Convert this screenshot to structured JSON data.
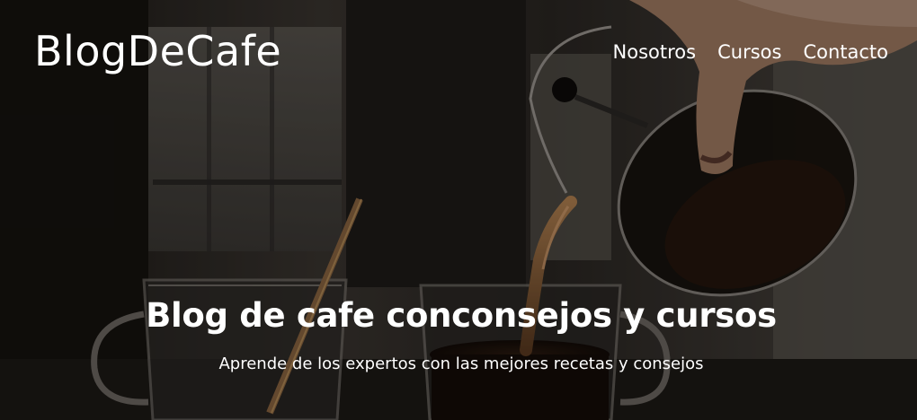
{
  "site": {
    "logo": "BlogDeCafe"
  },
  "nav": {
    "items": [
      {
        "label": "Nosotros"
      },
      {
        "label": "Cursos"
      },
      {
        "label": "Contacto"
      }
    ]
  },
  "hero": {
    "title": "Blog de cafe conconsejos y cursos",
    "subtitle": "Aprende de los expertos con las mejores recetas y consejos",
    "background_image": "coffee-pouring-photo"
  },
  "colors": {
    "text": "#ffffff",
    "overlay": "#000000"
  }
}
